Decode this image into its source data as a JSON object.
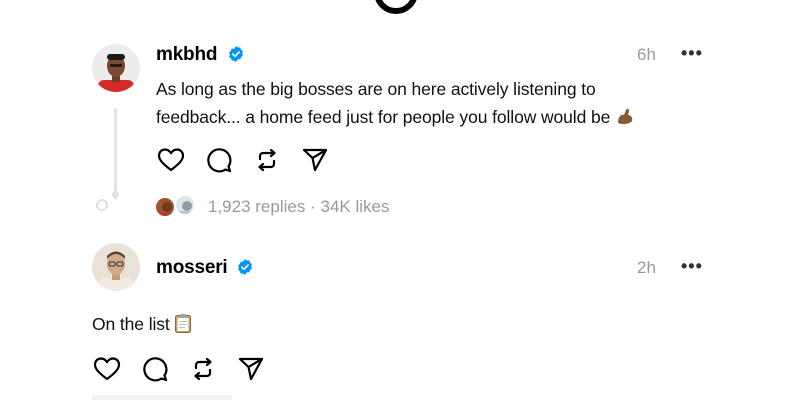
{
  "posts": [
    {
      "username": "mkbhd",
      "time": "6h",
      "more": "•••",
      "text_line1": "As long as the big bosses are on here actively listening to",
      "text_line2": "feedback... a home feed just for people you follow would be",
      "emoji": "flexed-biceps-emoji",
      "replies": "1,923 replies",
      "separator": "·",
      "likes": "34K likes"
    },
    {
      "username": "mosseri",
      "time": "2h",
      "more": "•••",
      "text": "On the list",
      "emoji": "clipboard-emoji"
    }
  ],
  "colors": {
    "verified": "#0095f6",
    "muted": "#9a9a9a",
    "thread_line": "#e3e3e3"
  },
  "icons": [
    "heart-icon",
    "comment-icon",
    "repost-icon",
    "share-icon",
    "more-icon",
    "verified-badge-icon"
  ]
}
